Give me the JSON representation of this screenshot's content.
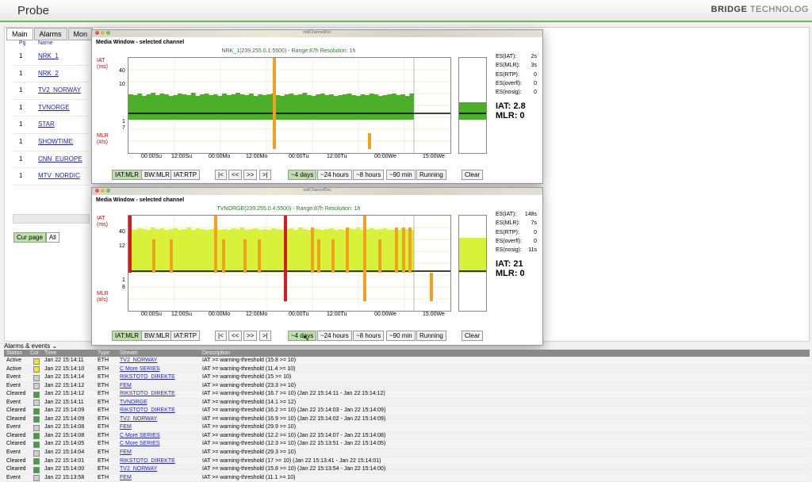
{
  "app": {
    "title": "Probe",
    "brand_bold": "BRIDGE",
    "brand_light": "TECHNOLOG"
  },
  "tabs": [
    "Main",
    "Alarms",
    "Mon"
  ],
  "channel_list": {
    "headers": {
      "pg": "Pg",
      "name": "Name"
    },
    "rows": [
      {
        "pg": "1",
        "name": "NRK_1"
      },
      {
        "pg": "1",
        "name": "NRK_2"
      },
      {
        "pg": "1",
        "name": "TV2_NORWAY"
      },
      {
        "pg": "1",
        "name": "TVNORGE"
      },
      {
        "pg": "1",
        "name": "STAR"
      },
      {
        "pg": "1",
        "name": "SHOWTIME"
      },
      {
        "pg": "1",
        "name": "CNN_EUROPE"
      },
      {
        "pg": "1",
        "name": "MTV_NORDIC"
      }
    ],
    "cur_page_label": "Cur page",
    "all_label": "All"
  },
  "windows": [
    {
      "titlebar": "mdiChannelDoc",
      "heading": "Media Window - selected channel",
      "chart_title": "NRK_1(239.255.0.1:5500) - Range:87h Resolution: 1h",
      "y_iat_label": "IAT (ms)",
      "y_mlr_label": "MLR (#/s)",
      "y_ticks_top": [
        "40",
        "10"
      ],
      "y_ticks_bottom": [
        "1",
        "7"
      ],
      "x_ticks": [
        "00:00Su",
        "12:00Su",
        "00:00Mo",
        "12:00Mo",
        "00:00Tu",
        "12:00Tu",
        "00:00We",
        "15:00We"
      ],
      "stats": [
        {
          "label": "ES(IAT):",
          "value": "2s"
        },
        {
          "label": "ES(MLR):",
          "value": "3s"
        },
        {
          "label": "ES(RTP):",
          "value": "0"
        },
        {
          "label": "ES(overfl):",
          "value": "0"
        },
        {
          "label": "ES(nosig):",
          "value": "0"
        }
      ],
      "iat_big": "IAT: 2.8",
      "mlr_big": "MLR: 0",
      "buttons_left": [
        "IAT:MLR",
        "BW:MLR",
        "IAT:RTP"
      ],
      "nav_buttons": [
        "|<",
        "<<",
        ">>",
        ">|"
      ],
      "range_buttons": [
        "~4 days",
        "~24 hours",
        "~8 hours",
        "~90 min",
        "Running"
      ],
      "clear_label": "Clear"
    },
    {
      "titlebar": "mdiChannelDoc",
      "heading": "Media Window - selected channel",
      "chart_title": "TVNORGE(239.255.0.4:5500) - Range:87h Resolution: 1h",
      "y_iat_label": "IAT (ms)",
      "y_mlr_label": "MLR (#/s)",
      "y_ticks_top": [
        "40",
        "12"
      ],
      "y_ticks_bottom": [
        "1",
        "8"
      ],
      "x_ticks": [
        "00:00Su",
        "12:00Su",
        "00:00Mo",
        "12:00Mo",
        "00:00Tu",
        "12:00Tu",
        "00:00We",
        "15:00We"
      ],
      "stats": [
        {
          "label": "ES(IAT):",
          "value": "148s"
        },
        {
          "label": "ES(MLR):",
          "value": "7s"
        },
        {
          "label": "ES(RTP):",
          "value": "0"
        },
        {
          "label": "ES(overfl):",
          "value": "0"
        },
        {
          "label": "ES(nosig):",
          "value": "11s"
        }
      ],
      "iat_big": "IAT: 21",
      "mlr_big": "MLR: 0",
      "buttons_left": [
        "IAT:MLR",
        "BW:MLR",
        "IAT:RTP"
      ],
      "nav_buttons": [
        "|<",
        "<<",
        ">>",
        ">|"
      ],
      "range_buttons": [
        "~4 days",
        "~24 hours",
        "~8 hours",
        "~90 min",
        "Running"
      ],
      "clear_label": "Clear"
    }
  ],
  "alarms": {
    "section_label": "Alarms & events",
    "headers": [
      "Status",
      "Col",
      "Time",
      "Type",
      "Stream",
      "Description"
    ],
    "rows": [
      {
        "status": "Active",
        "col": "#f1e62a",
        "time": "Jan 22 15:14:11",
        "type": "ETH",
        "stream": "TV2_NORWAY",
        "desc": "IAT >= warning-threshold (15.8 >= 10)"
      },
      {
        "status": "Active",
        "col": "#f1e62a",
        "time": "Jan 22 15:14:10",
        "type": "ETH",
        "stream": "C More SERIES",
        "desc": "IAT >= warning-threshold (11.4 >= 10)"
      },
      {
        "status": "Event",
        "col": "#cfcfcf",
        "time": "Jan 22 15:14:14",
        "type": "ETH",
        "stream": "RIKSTOTO_DIREKTE",
        "desc": "IAT >= warning-threshold (15 >= 10)"
      },
      {
        "status": "Event",
        "col": "#cfcfcf",
        "time": "Jan 22 15:14:12",
        "type": "ETH",
        "stream": "FEM",
        "desc": "IAT >= warning-threshold (23.3 >= 10)"
      },
      {
        "status": "Cleared",
        "col": "#3aa63a",
        "time": "Jan 22 15:14:12",
        "type": "ETH",
        "stream": "RIKSTOTO_DIREKTE",
        "desc": "IAT >= warning-threshold (16.7 >= 10) (Jan 22 15:14:11 - Jan 22 15:14:12)"
      },
      {
        "status": "Event",
        "col": "#cfcfcf",
        "time": "Jan 22 15:14:11",
        "type": "ETH",
        "stream": "TVNORGE",
        "desc": "IAT >= warning-threshold (14.1 >= 12)"
      },
      {
        "status": "Cleared",
        "col": "#3aa63a",
        "time": "Jan 22 15:14:09",
        "type": "ETH",
        "stream": "RIKSTOTO_DIREKTE",
        "desc": "IAT >= warning-threshold (16.2 >= 10) (Jan 22 15:14:03 - Jan 22 15:14:09)"
      },
      {
        "status": "Cleared",
        "col": "#3aa63a",
        "time": "Jan 22 15:14:09",
        "type": "ETH",
        "stream": "TV2_NORWAY",
        "desc": "IAT >= warning-threshold (16.9 >= 10) (Jan 22 15:14:02 - Jan 22 15:14:09)"
      },
      {
        "status": "Event",
        "col": "#cfcfcf",
        "time": "Jan 22 15:14:08",
        "type": "ETH",
        "stream": "FEM",
        "desc": "IAT >= warning-threshold (29.9 >= 10)"
      },
      {
        "status": "Cleared",
        "col": "#3aa63a",
        "time": "Jan 22 15:14:08",
        "type": "ETH",
        "stream": "C More SERIES",
        "desc": "IAT >= warning-threshold (12.2 >= 10) (Jan 22 15:14:07 - Jan 22 15:14:08)"
      },
      {
        "status": "Cleared",
        "col": "#3aa63a",
        "time": "Jan 22 15:14:05",
        "type": "ETH",
        "stream": "C More SERIES",
        "desc": "IAT >= warning-threshold (12.3 >= 10) (Jan 22 15:13:51 - Jan 22 15:14:05)"
      },
      {
        "status": "Event",
        "col": "#cfcfcf",
        "time": "Jan 22 15:14:04",
        "type": "ETH",
        "stream": "FEM",
        "desc": "IAT >= warning-threshold (29.3 >= 10)"
      },
      {
        "status": "Cleared",
        "col": "#3aa63a",
        "time": "Jan 22 15:14:01",
        "type": "ETH",
        "stream": "RIKSTOTO_DIREKTE",
        "desc": "IAT >= warning-threshold (17 >= 10) (Jan 22 15:13:41 - Jan 22 15:14:01)"
      },
      {
        "status": "Cleared",
        "col": "#3aa63a",
        "time": "Jan 22 15:14:00",
        "type": "ETH",
        "stream": "TV2_NORWAY",
        "desc": "IAT >= warning-threshold (15.8 >= 10) (Jan 22 15:13:54 - Jan 22 15:14:00)"
      },
      {
        "status": "Event",
        "col": "#cfcfcf",
        "time": "Jan 22 15:13:58",
        "type": "ETH",
        "stream": "FEM",
        "desc": "IAT >= warning-threshold (11.1 >= 10)"
      }
    ]
  },
  "colors": {
    "accent_green": "#6cbf3b",
    "plot_green": "#4caf2a",
    "plot_yellow": "#d8f23a",
    "spike_orange": "#f0a21e",
    "spike_red": "#d01e1e"
  }
}
